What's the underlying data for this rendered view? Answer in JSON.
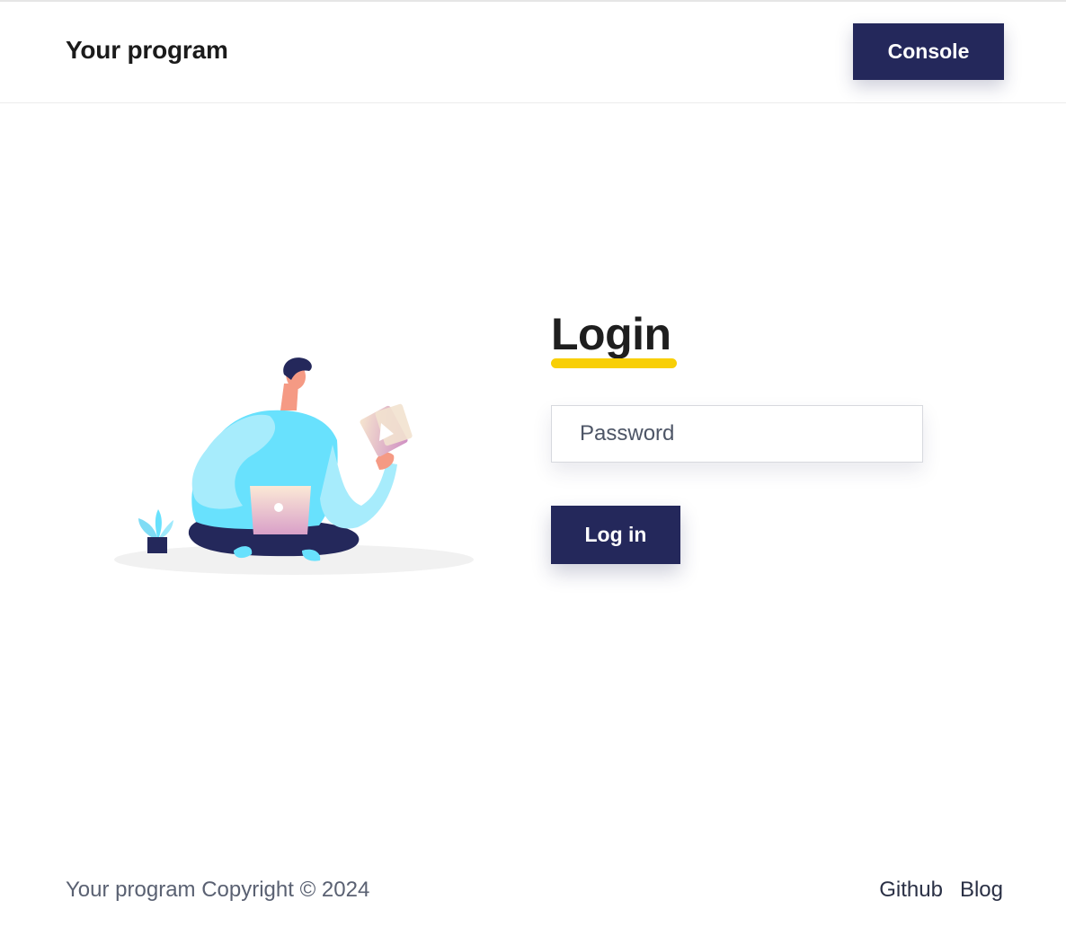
{
  "header": {
    "brand": "Your program",
    "console_label": "Console"
  },
  "login": {
    "title": "Login",
    "password_placeholder": "Password",
    "submit_label": "Log in"
  },
  "footer": {
    "copyright": "Your program Copyright © 2024",
    "links": [
      "Github",
      "Blog"
    ]
  },
  "colors": {
    "primary": "#24285b",
    "accent_underline": "#f8cf06",
    "shirt": "#68e1fd"
  },
  "illustration": {
    "subject": "person-with-laptop-illustration"
  }
}
